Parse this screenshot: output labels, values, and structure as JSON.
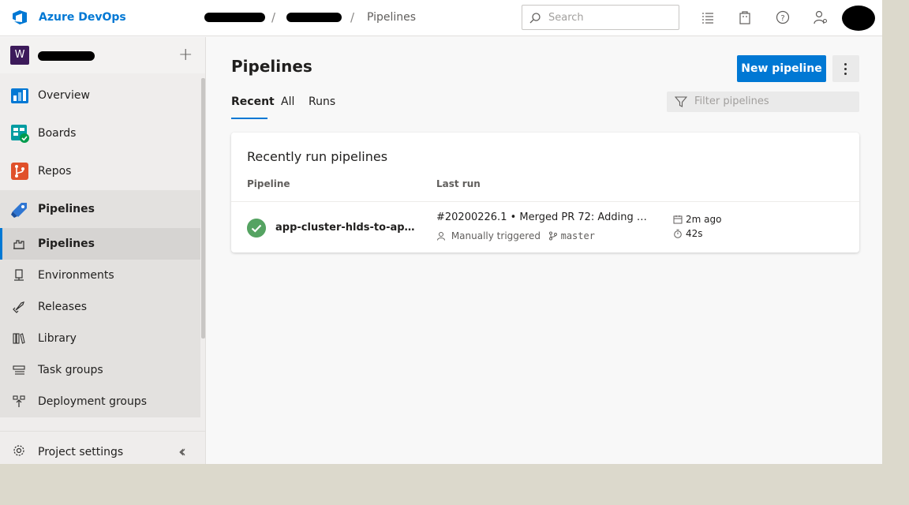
{
  "header": {
    "brand": "Azure DevOps",
    "breadcrumb_separator": "/",
    "breadcrumb_current": "Pipelines",
    "search_placeholder": "Search"
  },
  "sidebar": {
    "project_initial": "W",
    "nav": [
      {
        "label": "Overview",
        "icon": "overview-icon"
      },
      {
        "label": "Boards",
        "icon": "boards-icon"
      },
      {
        "label": "Repos",
        "icon": "repos-icon"
      },
      {
        "label": "Pipelines",
        "icon": "pipelines-icon"
      }
    ],
    "sub_nav": [
      {
        "label": "Pipelines",
        "icon": "pipelines-sub-icon"
      },
      {
        "label": "Environments",
        "icon": "environments-icon"
      },
      {
        "label": "Releases",
        "icon": "releases-icon"
      },
      {
        "label": "Library",
        "icon": "library-icon"
      },
      {
        "label": "Task groups",
        "icon": "task-groups-icon"
      },
      {
        "label": "Deployment groups",
        "icon": "deployment-groups-icon"
      }
    ],
    "settings_label": "Project settings"
  },
  "main": {
    "title": "Pipelines",
    "new_button": "New pipeline",
    "tabs": [
      "Recent",
      "All",
      "Runs"
    ],
    "filter_placeholder": "Filter pipelines",
    "card": {
      "title": "Recently run pipelines",
      "columns": [
        "Pipeline",
        "Last run"
      ],
      "rows": [
        {
          "name": "app-cluster-hlds-to-app-...",
          "run_title": "#20200226.1 • Merged PR 72: Adding ne...",
          "trigger": "Manually triggered",
          "branch": "master",
          "time_ago": "2m ago",
          "duration": "42s",
          "status": "succeeded"
        }
      ]
    }
  },
  "colors": {
    "accent": "#0078d4",
    "success": "#55a362"
  }
}
